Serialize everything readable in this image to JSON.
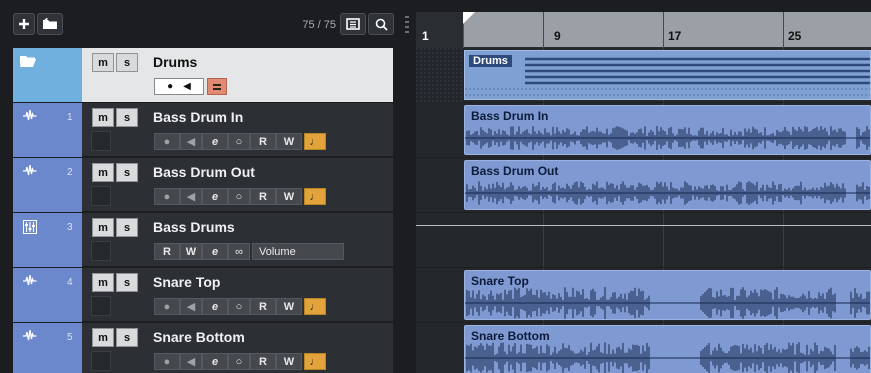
{
  "toolbar": {
    "add_track_icon": "plus-icon",
    "add_folder_icon": "add-folder-icon",
    "track_count": "75 / 75",
    "visibility_icon": "track-visibility-icon",
    "search_icon": "search-icon"
  },
  "ruler": {
    "bars": [
      "1",
      "9",
      "17",
      "25"
    ]
  },
  "folder_track": {
    "name": "Drums",
    "mute": "m",
    "solo": "s",
    "event_name": "Drums",
    "icon": "folder-open-icon"
  },
  "tracks": [
    {
      "number": "1",
      "name": "Bass Drum In",
      "type": "audio",
      "icon": "audio-waveform-icon",
      "mute": "m",
      "solo": "s",
      "event_name": "Bass Drum In"
    },
    {
      "number": "2",
      "name": "Bass Drum Out",
      "type": "audio",
      "icon": "audio-waveform-icon",
      "mute": "m",
      "solo": "s",
      "event_name": "Bass Drum Out"
    },
    {
      "number": "3",
      "name": "Bass Drums",
      "type": "group",
      "icon": "group-channel-icon",
      "mute": "m",
      "solo": "s",
      "automation_param": "Volume"
    },
    {
      "number": "4",
      "name": "Snare Top",
      "type": "audio",
      "icon": "audio-waveform-icon",
      "mute": "m",
      "solo": "s",
      "event_name": "Snare Top"
    },
    {
      "number": "5",
      "name": "Snare Bottom",
      "type": "audio",
      "icon": "audio-waveform-icon",
      "mute": "m",
      "solo": "s",
      "event_name": "Snare Bottom"
    }
  ],
  "controls": {
    "read": "R",
    "write": "W"
  },
  "colors": {
    "folder_color": "#6fb0df",
    "track_color": "#6b88cc",
    "event_color": "#7f9ad2",
    "note_button": "#e2a43a"
  }
}
